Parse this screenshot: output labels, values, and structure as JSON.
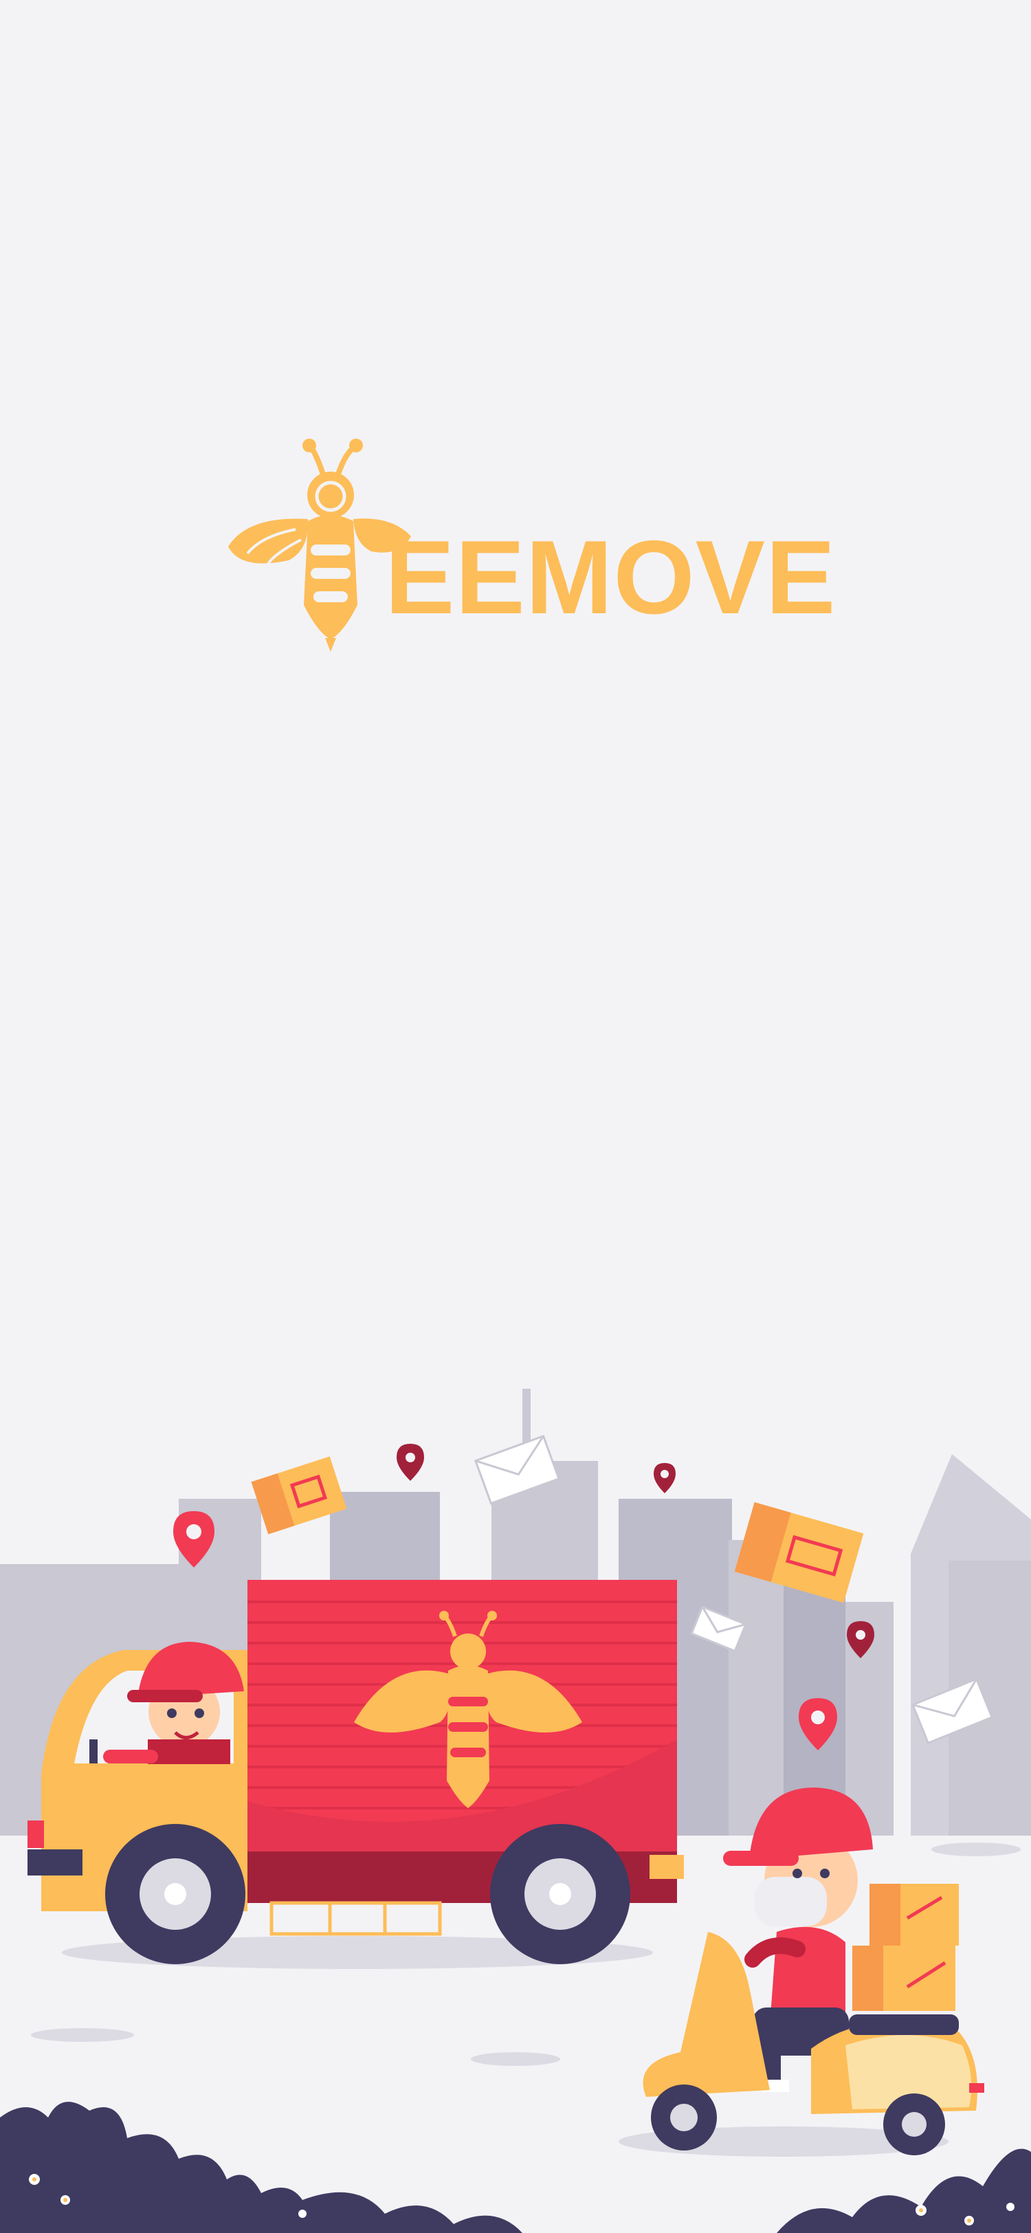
{
  "splash": {
    "logo_text": "EEMOVE"
  },
  "colors": {
    "background": "#f3f3f6",
    "brand_yellow": "#fdbd58",
    "truck_red": "#f23a53",
    "ink_navy": "#3f3a60",
    "building_gray": "#c9c8d3"
  },
  "illustration": {
    "icons": [
      "bee-icon",
      "delivery-truck-icon",
      "scooter-courier-icon",
      "parcel-box-icon",
      "envelope-icon",
      "location-pin-icon",
      "city-skyline",
      "bushes"
    ]
  }
}
